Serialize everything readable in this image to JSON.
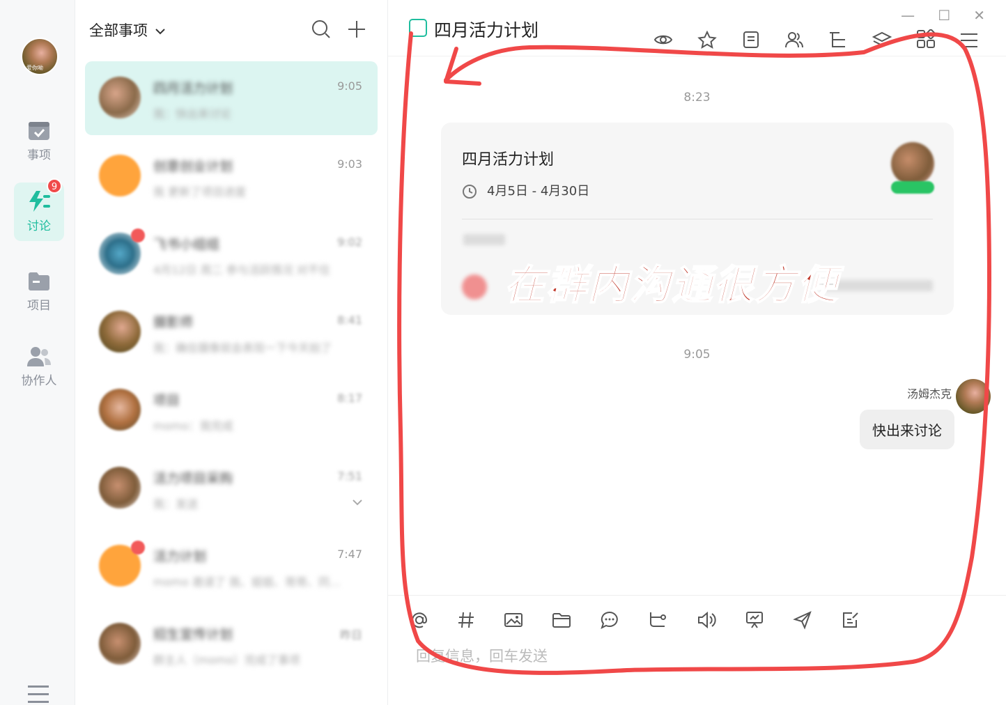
{
  "nav": {
    "avatar_caption": "爱你呦",
    "items": [
      {
        "label": "事项",
        "icon": "calendar-check-icon"
      },
      {
        "label": "讨论",
        "icon": "discussion-icon",
        "badge": "9"
      },
      {
        "label": "项目",
        "icon": "folder-icon"
      },
      {
        "label": "协作人",
        "icon": "contacts-icon"
      }
    ],
    "menu_icon": "hamburger-menu-icon"
  },
  "list": {
    "filter_label": "全部事项",
    "conversations": [
      {
        "name": "四月活力计划",
        "preview": "我：快出来讨论",
        "time": "9:05",
        "selected": true
      },
      {
        "name": "创意创业计划",
        "preview": "我 更新了项目进度",
        "time": "9:03"
      },
      {
        "name": "飞书小组组",
        "preview": "4月12日 周二 参与活跃情况 对不住",
        "time": "9:02"
      },
      {
        "name": "摄影师",
        "preview": "我：确信摄像就会表现一下今天拍了",
        "time": "8:41"
      },
      {
        "name": "项目",
        "preview": "momo：我完成",
        "time": "8:17"
      },
      {
        "name": "活力项目采购",
        "preview": "我：发送",
        "time": "7:51"
      },
      {
        "name": "活力计划",
        "preview": "momo 邀请了 我、姐姐、哥哥、同…",
        "time": "7:47"
      },
      {
        "name": "招生宣传计划",
        "preview": "群主人（momo）完成了事项",
        "time": "昨日"
      }
    ]
  },
  "chat": {
    "title": "四月活力计划",
    "window_controls": [
      "—",
      "☐",
      "✕"
    ],
    "toolbar_icons": [
      "eye-icon",
      "star-icon",
      "note-icon",
      "members-icon",
      "tree-icon",
      "layers-icon",
      "apps-grid-icon",
      "menu-icon"
    ],
    "timestamps": [
      "8:23",
      "9:05"
    ],
    "card": {
      "title": "四月活力计划",
      "date_range": "4月5日 - 4月30日"
    },
    "overlay_text": "在群内沟通很方便",
    "message": {
      "sender": "汤姆杰克",
      "text": "快出来讨论"
    },
    "input_placeholder": "回复信息，回车发送",
    "input_tools": [
      "at-icon",
      "hash-icon",
      "image-icon",
      "folder-icon",
      "chat-bubble-icon",
      "flow-icon",
      "voice-icon",
      "vote-icon",
      "send-icon",
      "edit-icon"
    ]
  }
}
